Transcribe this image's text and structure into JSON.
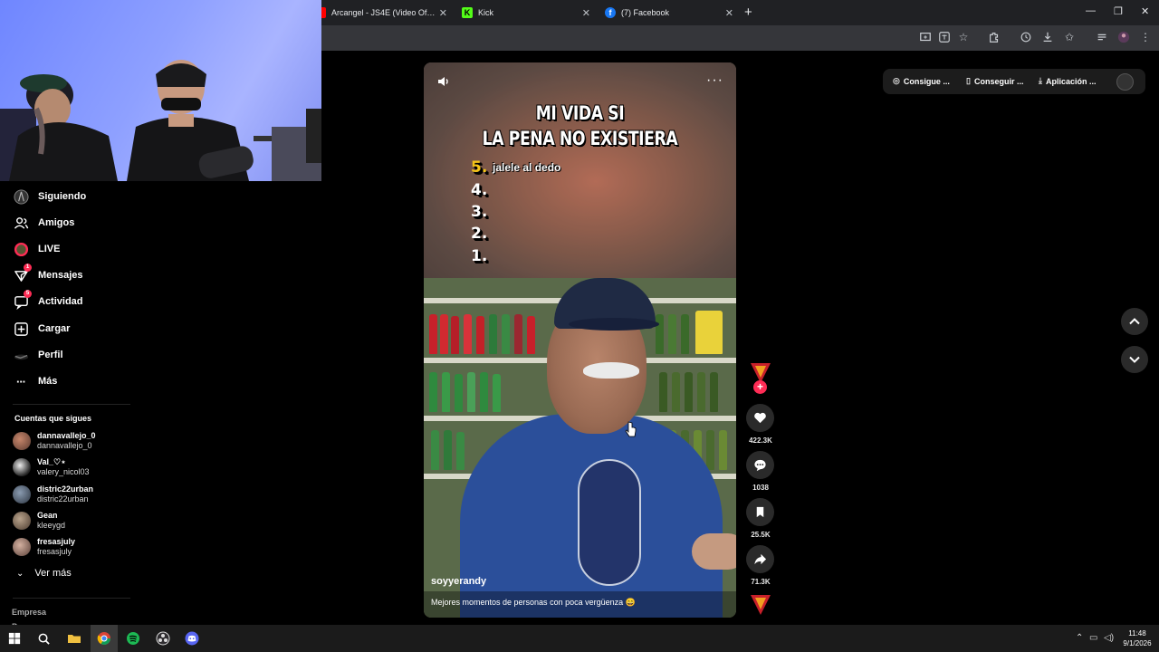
{
  "browser": {
    "tabs": [
      {
        "title": "Arcangel - JS4E (Video Oficial) |",
        "favicon": "youtube-icon"
      },
      {
        "title": "Kick",
        "favicon": "kick-icon"
      },
      {
        "title": "(7) Facebook",
        "favicon": "facebook-icon"
      }
    ],
    "new_tab_label": "+"
  },
  "sidebar": {
    "items": [
      {
        "label": "Siguiendo",
        "icon": "following-icon"
      },
      {
        "label": "Amigos",
        "icon": "friends-icon"
      },
      {
        "label": "LIVE",
        "icon": "live-icon"
      },
      {
        "label": "Mensajes",
        "icon": "messages-icon",
        "badge": "1"
      },
      {
        "label": "Actividad",
        "icon": "activity-icon",
        "badge": "5"
      },
      {
        "label": "Cargar",
        "icon": "upload-icon"
      },
      {
        "label": "Perfil",
        "icon": "profile-icon"
      },
      {
        "label": "Más",
        "icon": "more-icon"
      }
    ],
    "following_title": "Cuentas que sigues",
    "accounts": [
      {
        "name": "dannavallejo_0",
        "handle": "dannavallejo_0"
      },
      {
        "name": "Val_♡⋆",
        "handle": "valery_nicol03"
      },
      {
        "name": "distric22urban",
        "handle": "distric22urban"
      },
      {
        "name": "Gean",
        "handle": "kleeygd"
      },
      {
        "name": "fresasjuly",
        "handle": "fresasjuly"
      }
    ],
    "see_more": "Ver más",
    "footer": [
      "Empresa",
      "Programa"
    ]
  },
  "video": {
    "title_line1": "MI VIDA SI",
    "title_line2": "LA PENA NO EXISTIERA",
    "ranks": [
      "5.",
      "4.",
      "3.",
      "2.",
      "1."
    ],
    "rank5_text": "jalele al dedo",
    "author": "soyyerandy",
    "caption": "Mejores momentos de personas con poca vergüenza 😄",
    "more_label": "···"
  },
  "actions": {
    "likes": "422.3K",
    "comments": "1038",
    "saves": "25.5K",
    "shares": "71.3K"
  },
  "top_right": {
    "coins": "Consigue ...",
    "get_app": "Conseguir ...",
    "app": "Aplicación ..."
  },
  "taskbar": {
    "time": "11:48",
    "date": "9/1/2026"
  },
  "colors": {
    "accent": "#fe2c55",
    "background": "#000000"
  }
}
